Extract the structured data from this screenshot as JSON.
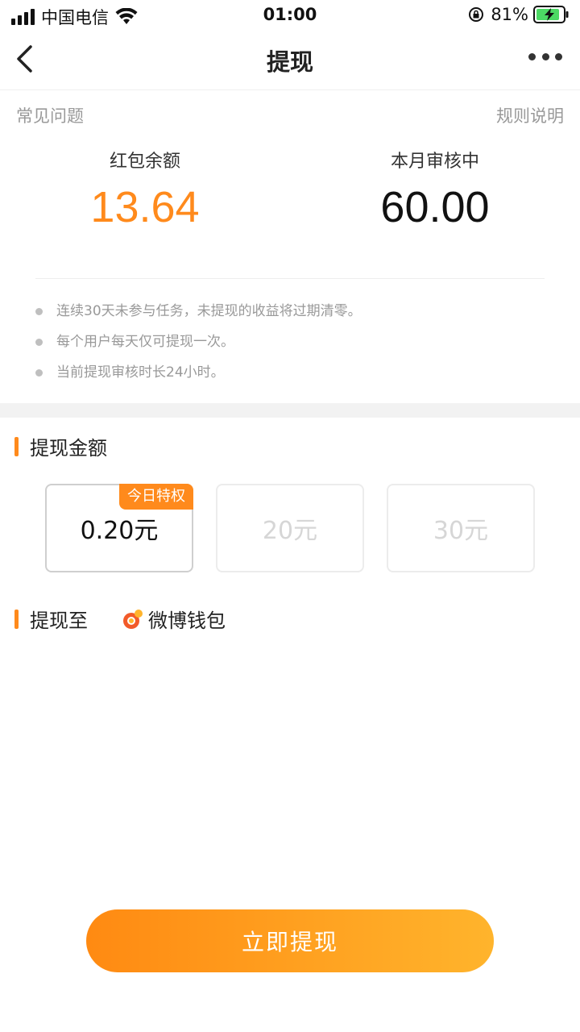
{
  "status_bar": {
    "carrier": "中国电信",
    "time": "01:00",
    "battery_percent": "81%"
  },
  "nav": {
    "title": "提现"
  },
  "links": {
    "faq": "常见问题",
    "rules": "规则说明"
  },
  "balances": {
    "red_packet_label": "红包余额",
    "red_packet_value": "13.64",
    "reviewing_label": "本月审核中",
    "reviewing_value": "60.00"
  },
  "notes": [
    "连续30天未参与任务，未提现的收益将过期清零。",
    "每个用户每天仅可提现一次。",
    "当前提现审核时长24小时。"
  ],
  "amount_section": {
    "title": "提现金额",
    "options": [
      {
        "label": "0.20元",
        "badge": "今日特权",
        "selected": true
      },
      {
        "label": "20元",
        "disabled": true
      },
      {
        "label": "30元",
        "disabled": true
      }
    ]
  },
  "destination": {
    "title": "提现至",
    "wallet_name": "微博钱包"
  },
  "cta": {
    "label": "立即提现"
  },
  "colors": {
    "accent": "#ff8a1c",
    "cta_start": "#ff8a12",
    "cta_end": "#ffb42c"
  }
}
